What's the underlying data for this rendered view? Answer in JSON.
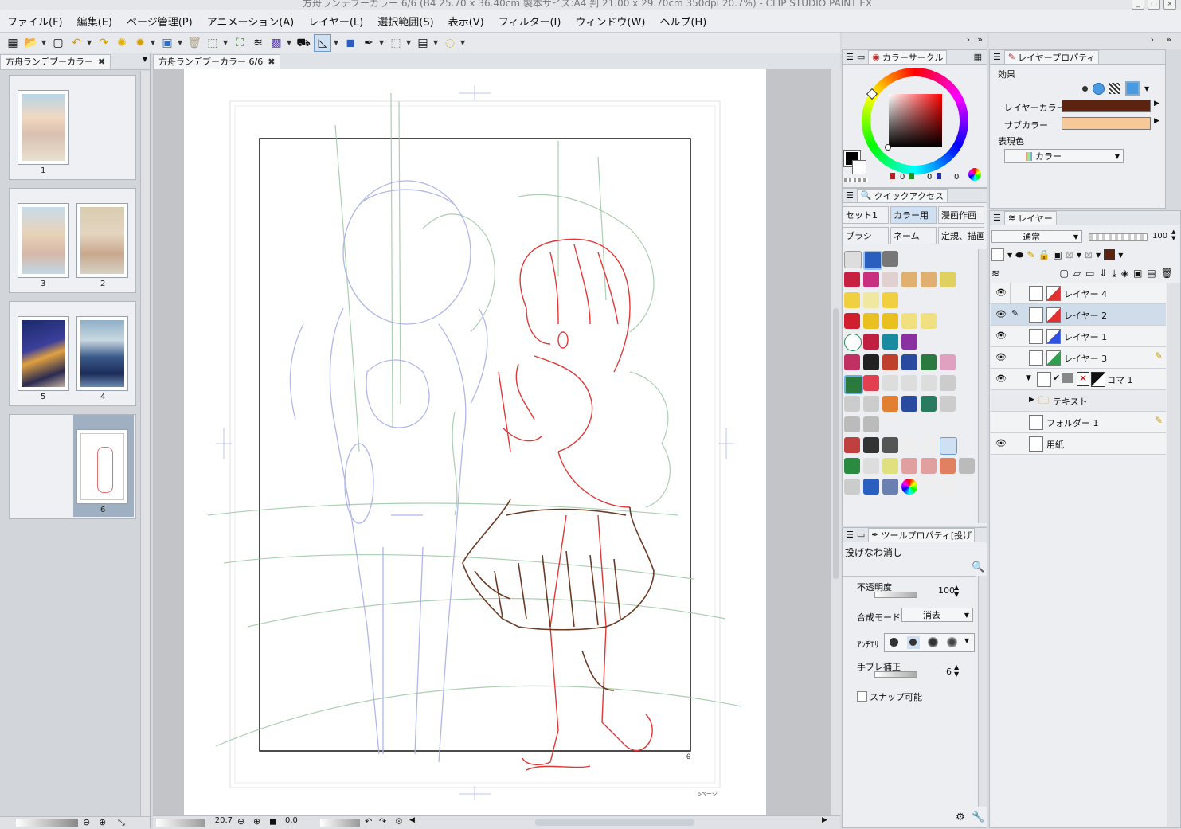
{
  "window": {
    "title": "方舟ランデブーカラー 6/6 (B4 25.70 x 36.40cm 製本サイズ:A4 判 21.00 x 29.70cm 350dpi 20.7%) - CLIP STUDIO PAINT EX"
  },
  "menu": [
    "ファイル(F)",
    "編集(E)",
    "ページ管理(P)",
    "アニメーション(A)",
    "レイヤー(L)",
    "選択範囲(S)",
    "表示(V)",
    "フィルター(I)",
    "ウィンドウ(W)",
    "ヘルプ(H)"
  ],
  "tabs": {
    "page_manager": "方舟ランデブーカラー",
    "canvas": "方舟ランデブーカラー 6/6"
  },
  "pages": [
    {
      "label": "1"
    },
    {
      "label": "3"
    },
    {
      "label": "2"
    },
    {
      "label": "5"
    },
    {
      "label": "4"
    },
    {
      "label": "6"
    }
  ],
  "canvas": {
    "page_number_mark": "6",
    "corner_note": "6ページ"
  },
  "status": {
    "zoom": "20.7",
    "rotation": "0.0"
  },
  "color_circle": {
    "tab_label": "カラーサークル",
    "main_color": "#ff0000",
    "rgb": [
      "0",
      "0",
      "0"
    ]
  },
  "quick_access": {
    "tab_label": "クイックアクセス",
    "tabs": [
      "セット1",
      "カラー用",
      "漫画作画",
      "ブラシ",
      "ネーム",
      "定規、描画"
    ]
  },
  "tool_property": {
    "tab_label": "ツールプロパティ[投げ",
    "tool_name": "投げなわ消し",
    "opacity_label": "不透明度",
    "opacity_value": "100",
    "blend_label": "合成モード",
    "blend_value": "消去",
    "antialias_label": "ｱﾝﾁｴﾘ",
    "stabilization_label": "手ブレ補正",
    "stabilization_value": "6",
    "snap_label": "スナップ可能"
  },
  "layer_property": {
    "tab_label": "レイヤープロパティ",
    "effect_label": "効果",
    "layer_color_label": "レイヤーカラー",
    "layer_color": "#5a2410",
    "sub_color_label": "サブカラー",
    "sub_color": "#f7c898",
    "expression_label": "表現色",
    "expression_value": "カラー"
  },
  "layers_panel": {
    "tab_label": "レイヤー",
    "blend_mode": "通常",
    "opacity": "100",
    "layers": [
      {
        "name": "レイヤー 4"
      },
      {
        "name": "レイヤー 2"
      },
      {
        "name": "レイヤー 1"
      },
      {
        "name": "レイヤー 3"
      },
      {
        "name": "コマ 1"
      },
      {
        "name": "テキスト"
      },
      {
        "name": "フォルダー 1"
      },
      {
        "name": "用紙"
      }
    ]
  }
}
